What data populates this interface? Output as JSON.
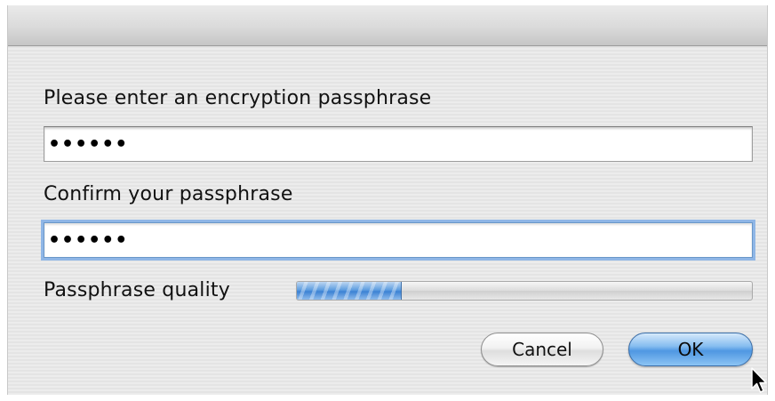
{
  "dialog": {
    "passphrase_label": "Please enter an encryption passphrase",
    "passphrase_value": "••••••",
    "confirm_label": "Confirm your passphrase",
    "confirm_value": "••••••",
    "quality_label": "Passphrase quality",
    "quality_level_percent": 23,
    "cancel_label": "Cancel",
    "ok_label": "OK"
  },
  "colors": {
    "focus_ring": "#8fb6e6",
    "progress_fill": "#4f8fdc",
    "ok_button": "#5f9ee6"
  },
  "icons": {
    "cursor": "arrow-cursor-icon"
  }
}
